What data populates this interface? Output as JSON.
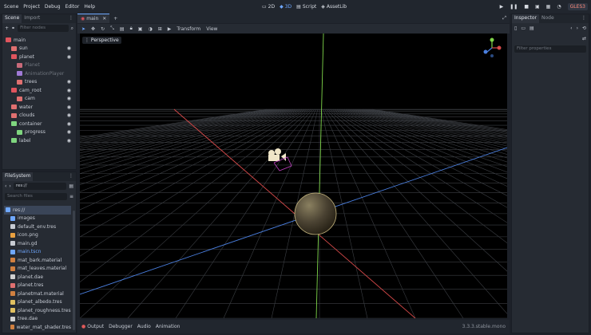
{
  "menu": [
    "Scene",
    "Project",
    "Debug",
    "Editor",
    "Help"
  ],
  "workspaces": {
    "w2d": "2D",
    "w3d": "3D",
    "script": "Script",
    "assetlib": "AssetLib"
  },
  "playbar": {
    "badge": "GLES3"
  },
  "scene_dock": {
    "tabs": [
      "Scene",
      "Import"
    ],
    "filter_placeholder": "Filter nodes",
    "nodes": [
      {
        "label": "main",
        "depth": 0,
        "color": "#e0555e",
        "dim": false,
        "eye": false
      },
      {
        "label": "sun",
        "depth": 1,
        "color": "#e07070",
        "dim": false,
        "eye": true
      },
      {
        "label": "planet",
        "depth": 1,
        "color": "#e0555e",
        "dim": false,
        "eye": true
      },
      {
        "label": "Planet",
        "depth": 2,
        "color": "#c96a7a",
        "dim": true,
        "eye": false
      },
      {
        "label": "AnimationPlayer",
        "depth": 2,
        "color": "#a07ad6",
        "dim": true,
        "eye": false
      },
      {
        "label": "trees",
        "depth": 2,
        "color": "#e07070",
        "dim": false,
        "eye": true
      },
      {
        "label": "cam_root",
        "depth": 1,
        "color": "#e0555e",
        "dim": false,
        "eye": true
      },
      {
        "label": "cam",
        "depth": 2,
        "color": "#e07070",
        "dim": false,
        "eye": true
      },
      {
        "label": "water",
        "depth": 1,
        "color": "#e07070",
        "dim": false,
        "eye": true
      },
      {
        "label": "clouds",
        "depth": 1,
        "color": "#e07070",
        "dim": false,
        "eye": true
      },
      {
        "label": "container",
        "depth": 1,
        "color": "#7fd67f",
        "dim": false,
        "eye": true
      },
      {
        "label": "progress",
        "depth": 2,
        "color": "#7fd67f",
        "dim": false,
        "eye": true
      },
      {
        "label": "label",
        "depth": 1,
        "color": "#7fd67f",
        "dim": false,
        "eye": true
      }
    ]
  },
  "filesystem": {
    "tab": "FileSystem",
    "path": "res://",
    "search_placeholder": "Search files",
    "files": [
      {
        "name": "res://",
        "color": "#6fa8ff",
        "sel": true,
        "depth": 0
      },
      {
        "name": "images",
        "color": "#6fa8ff",
        "sel": false,
        "depth": 1
      },
      {
        "name": "default_env.tres",
        "color": "#c8ccd3",
        "sel": false,
        "depth": 1
      },
      {
        "name": "icon.png",
        "color": "#e8a040",
        "sel": false,
        "depth": 1
      },
      {
        "name": "main.gd",
        "color": "#c8ccd3",
        "sel": false,
        "depth": 1
      },
      {
        "name": "main.tscn",
        "color": "#6fa8ff",
        "sel": false,
        "depth": 1
      },
      {
        "name": "mat_bark.material",
        "color": "#d08040",
        "sel": false,
        "depth": 1
      },
      {
        "name": "mat_leaves.material",
        "color": "#d08040",
        "sel": false,
        "depth": 1
      },
      {
        "name": "planet.dae",
        "color": "#d0d0d0",
        "sel": false,
        "depth": 1
      },
      {
        "name": "planet.tres",
        "color": "#e07070",
        "sel": false,
        "depth": 1
      },
      {
        "name": "planetmat.material",
        "color": "#d08040",
        "sel": false,
        "depth": 1
      },
      {
        "name": "planet_albedo.tres",
        "color": "#e0c060",
        "sel": false,
        "depth": 1
      },
      {
        "name": "planet_roughness.tres",
        "color": "#e0c060",
        "sel": false,
        "depth": 1
      },
      {
        "name": "tree.dae",
        "color": "#d0d0d0",
        "sel": false,
        "depth": 1
      },
      {
        "name": "water_mat_shader.tres",
        "color": "#d08040",
        "sel": false,
        "depth": 1
      }
    ]
  },
  "editor_tabs": {
    "main": "main"
  },
  "viewport": {
    "toolbar": {
      "transform": "Transform",
      "view": "View"
    },
    "perspective": "Perspective"
  },
  "inspector": {
    "tabs": [
      "Inspector",
      "Node"
    ],
    "filter_placeholder": "Filter properties"
  },
  "bottom": {
    "tabs": [
      "Output",
      "Debugger",
      "Audio",
      "Animation"
    ],
    "version": "3.3.3.stable.mono"
  },
  "colors": {
    "accent": "#6fa8ff",
    "x_axis": "#d94a4a",
    "y_axis": "#7fd64a",
    "z_axis": "#4a7fe0"
  }
}
